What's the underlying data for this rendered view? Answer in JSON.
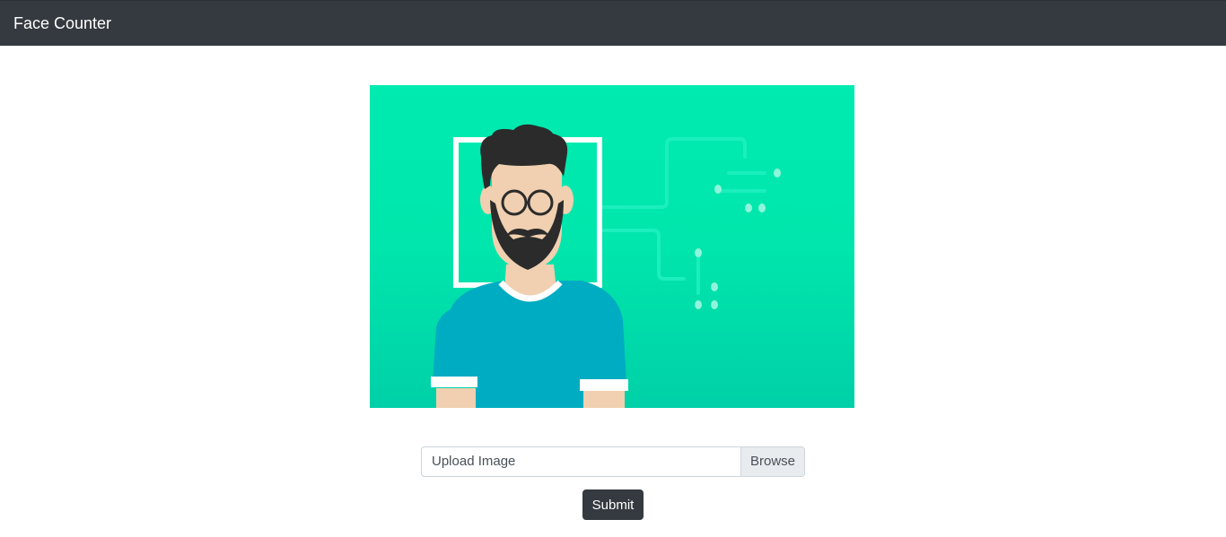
{
  "navbar": {
    "brand": "Face Counter"
  },
  "hero": {
    "description": "face-detection-illustration",
    "colors": {
      "background": "#00e8ad",
      "shirt": "#00acc1",
      "skin": "#f0d0b0",
      "hair": "#2b2b2b",
      "frame": "#ffffff"
    }
  },
  "upload": {
    "label": "Upload Image",
    "browse_label": "Browse"
  },
  "submit": {
    "label": "Submit"
  }
}
